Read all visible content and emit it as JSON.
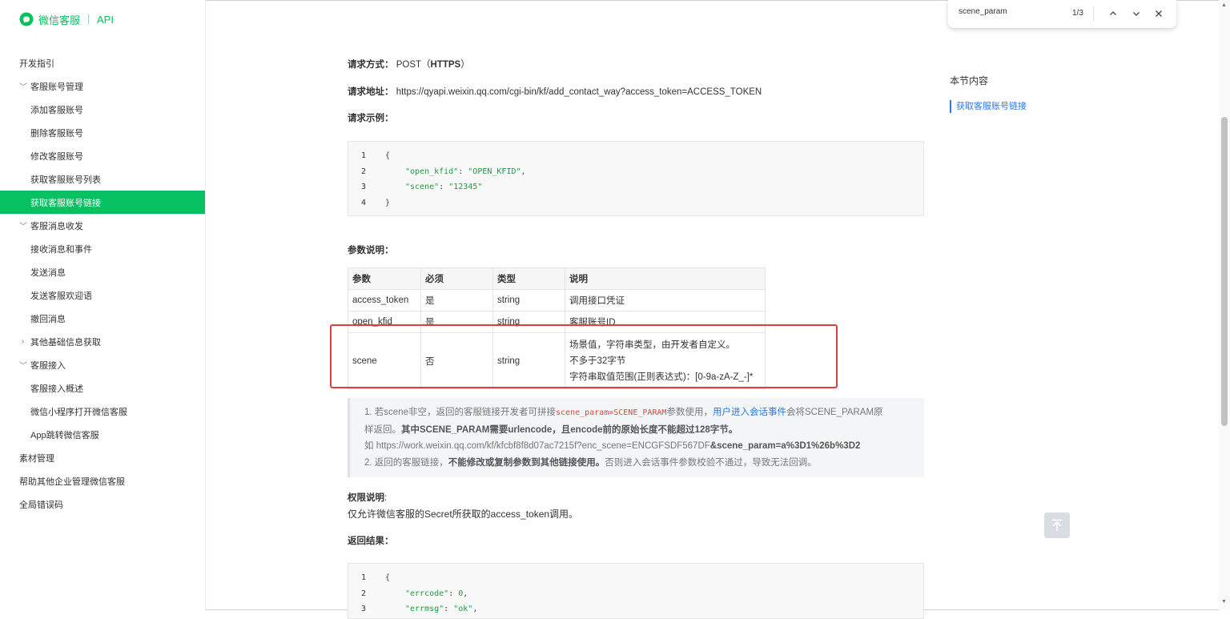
{
  "header": {
    "brand": "微信客服",
    "section": "API"
  },
  "sidebar": {
    "items": [
      {
        "label": "开发指引",
        "level": "lvl0",
        "chev": "",
        "active": false
      },
      {
        "label": "客服账号管理",
        "level": "group",
        "chev": "﹀",
        "active": false
      },
      {
        "label": "添加客服账号",
        "level": "lvl1",
        "chev": "",
        "active": false
      },
      {
        "label": "删除客服账号",
        "level": "lvl1",
        "chev": "",
        "active": false
      },
      {
        "label": "修改客服账号",
        "level": "lvl1",
        "chev": "",
        "active": false
      },
      {
        "label": "获取客服账号列表",
        "level": "lvl1",
        "chev": "",
        "active": false
      },
      {
        "label": "获取客服账号链接",
        "level": "lvl1",
        "chev": "",
        "active": true
      },
      {
        "label": "客服消息收发",
        "level": "group",
        "chev": "﹀",
        "active": false
      },
      {
        "label": "接收消息和事件",
        "level": "lvl1",
        "chev": "",
        "active": false
      },
      {
        "label": "发送消息",
        "level": "lvl1",
        "chev": "",
        "active": false
      },
      {
        "label": "发送客服欢迎语",
        "level": "lvl1",
        "chev": "",
        "active": false
      },
      {
        "label": "撤回消息",
        "level": "lvl1",
        "chev": "",
        "active": false
      },
      {
        "label": "其他基础信息获取",
        "level": "group",
        "chev": "›",
        "active": false
      },
      {
        "label": "客服接入",
        "level": "group",
        "chev": "﹀",
        "active": false
      },
      {
        "label": "客服接入概述",
        "level": "lvl1",
        "chev": "",
        "active": false
      },
      {
        "label": "微信小程序打开微信客服",
        "level": "lvl1",
        "chev": "",
        "active": false
      },
      {
        "label": "App跳转微信客服",
        "level": "lvl1",
        "chev": "",
        "active": false
      },
      {
        "label": "素材管理",
        "level": "lvl0",
        "chev": "",
        "active": false
      },
      {
        "label": "帮助其他企业管理微信客服",
        "level": "lvl0",
        "chev": "",
        "active": false
      },
      {
        "label": "全局错误码",
        "level": "lvl0",
        "chev": "",
        "active": false
      }
    ]
  },
  "main": {
    "method_label": "请求方式：",
    "method_value": "POST（",
    "method_bold": "HTTPS",
    "method_end": "）",
    "url_label": "请求地址：",
    "url_value": "https://qyapi.weixin.qq.com/cgi-bin/kf/add_contact_way?access_token=ACCESS_TOKEN",
    "example_label": "请求示例：",
    "request_code": [
      {
        "ln": "1",
        "text": "{"
      },
      {
        "ln": "2",
        "key": "\"open_kfid\"",
        "sep": ": ",
        "val": "\"OPEN_KFID\"",
        "tail": ","
      },
      {
        "ln": "3",
        "key": "\"scene\"",
        "sep": ": ",
        "val": "\"12345\"",
        "tail": ""
      },
      {
        "ln": "4",
        "text": "}"
      }
    ],
    "params_label": "参数说明：",
    "params_table": {
      "headers": [
        "参数",
        "必须",
        "类型",
        "说明"
      ],
      "rows": [
        [
          "access_token",
          "是",
          "string",
          "调用接口凭证"
        ],
        [
          "open_kfid",
          "是",
          "string",
          "客服账号ID"
        ]
      ],
      "scene_row": {
        "name": "scene",
        "required": "否",
        "type": "string",
        "desc1": "场景值，字符串类型，由开发者自定义。",
        "desc2": "不多于32字节",
        "desc3": "字符串取值范围(正则表达式)：[0-9a-zA-Z_-]*"
      }
    },
    "note": {
      "l1a": "1. 若scene非空，返回的客服链接开发者可拼接",
      "l1code": "scene_param=SCENE_PARAM",
      "l1b": "参数使用，",
      "l1link": "用户进入会话事件",
      "l1c": "会将SCENE_PARAM原",
      "l2a": "样返回。",
      "l2bold": "其中SCENE_PARAM需要urlencode，且encode前的原始长度不能超过128字节。",
      "l3a": "如 https://work.weixin.qq.com/kf/kfcbf8f8d07ac7215f?enc_scene=ENCGFSDF567DF",
      "l3bold": "&scene_param=a%3D1%26b%3D2",
      "l4a": "2. 返回的客服链接，",
      "l4bold": "不能修改或复制参数到其他链接使用。",
      "l4b": "否则进入会话事件参数校验不通过，导致无法回调。"
    },
    "perm_label": "权限说明",
    "perm_colon": ":",
    "perm_text": "仅允许微信客服的Secret所获取的access_token调用。",
    "result_label": "返回结果：",
    "result_code": [
      {
        "ln": "1",
        "text": "{"
      },
      {
        "ln": "2",
        "key": "\"errcode\"",
        "sep": ": ",
        "val": "0",
        "tail": ","
      },
      {
        "ln": "3",
        "key": "\"errmsg\"",
        "sep": ": ",
        "val": "\"ok\"",
        "tail": ","
      }
    ]
  },
  "toc": {
    "title": "本节内容",
    "link": "获取客服账号链接"
  },
  "findbar": {
    "query": "scene_param",
    "count": "1/3"
  },
  "colors": {
    "brand": "#07c160",
    "link": "#2a7ae2",
    "highlight": "#e43c3c"
  }
}
